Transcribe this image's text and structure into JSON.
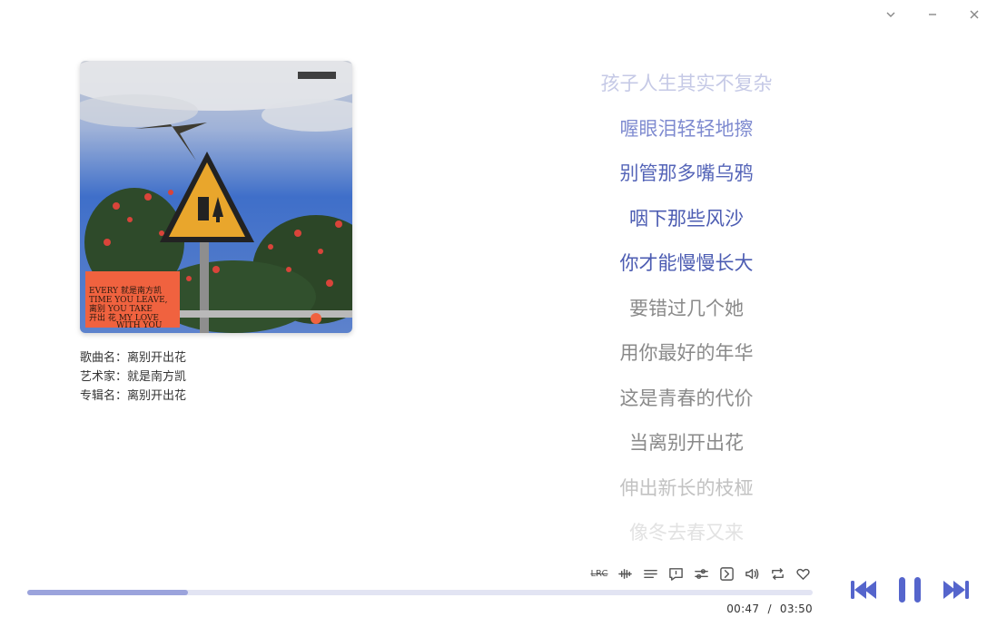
{
  "window": {
    "icons": [
      "chevron-down-icon",
      "minimize-icon",
      "close-icon"
    ]
  },
  "song": {
    "title_label": "歌曲名：",
    "title": "离别开出花",
    "artist_label": "艺术家：",
    "artist": "就是南方凯",
    "album_label": "专辑名：",
    "album": "离别开出花"
  },
  "cover": {
    "text_lines": [
      "EVERY 就是南方凯",
      "TIME YOU LEAVE,",
      "离别 YOU TAKE",
      "开出 花 MY LOVE",
      "WITH YOU"
    ],
    "colors": {
      "sky": "#3f6fc9",
      "orange": "#f0623f",
      "sign": "#e9a62c"
    }
  },
  "lyrics": [
    {
      "text": "孩子人生其实不复杂",
      "color": "#c5c9e6"
    },
    {
      "text": "喔眼泪轻轻地擦",
      "color": "#7f8bd0"
    },
    {
      "text": "别管那多嘴乌鸦",
      "color": "#5565b8"
    },
    {
      "text": "咽下那些风沙",
      "color": "#4c5cb2"
    },
    {
      "text": "你才能慢慢长大",
      "color": "#4c5cb2"
    },
    {
      "text": "要错过几个她",
      "color": "#8a8a8a"
    },
    {
      "text": "用你最好的年华",
      "color": "#8a8a8a"
    },
    {
      "text": "这是青春的代价",
      "color": "#8a8a8a"
    },
    {
      "text": "当离别开出花",
      "color": "#8a8a8a"
    },
    {
      "text": "伸出新长的枝桠",
      "color": "#c2c2c2"
    },
    {
      "text": "像冬去春又来",
      "color": "#e2e2e2"
    }
  ],
  "toolbar": {
    "lrc_label": "LRC",
    "icons": [
      "lrc-icon",
      "waveform-icon",
      "playlist-icon",
      "comment-icon",
      "equalizer-icon",
      "next-frame-icon",
      "volume-icon",
      "repeat-icon",
      "favorite-icon"
    ]
  },
  "progress": {
    "fraction": 0.205,
    "current": "00:47",
    "separator": "/",
    "total": "03:50"
  },
  "playback": {
    "icons": [
      "previous-icon",
      "pause-icon",
      "next-icon"
    ],
    "accent": "#5565cc"
  }
}
